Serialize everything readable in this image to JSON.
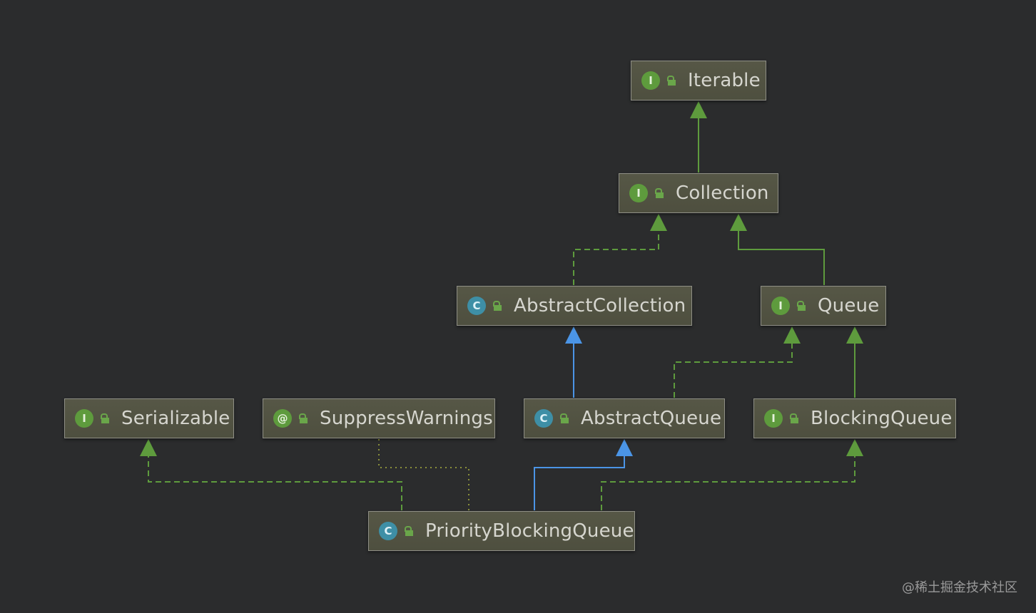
{
  "nodes": {
    "iterable": {
      "label": "Iterable",
      "kind": "I",
      "icon": "interface-icon"
    },
    "collection": {
      "label": "Collection",
      "kind": "I",
      "icon": "interface-icon"
    },
    "abstract_collection": {
      "label": "AbstractCollection",
      "kind": "C",
      "icon": "abstract-class-icon"
    },
    "queue": {
      "label": "Queue",
      "kind": "I",
      "icon": "interface-icon"
    },
    "serializable": {
      "label": "Serializable",
      "kind": "I",
      "icon": "interface-icon"
    },
    "suppress_warnings": {
      "label": "SuppressWarnings",
      "kind": "@",
      "icon": "annotation-icon"
    },
    "abstract_queue": {
      "label": "AbstractQueue",
      "kind": "C",
      "icon": "abstract-class-icon"
    },
    "blocking_queue": {
      "label": "BlockingQueue",
      "kind": "I",
      "icon": "interface-icon"
    },
    "priority_blocking_queue": {
      "label": "PriorityBlockingQueue",
      "kind": "C",
      "icon": "class-icon"
    }
  },
  "colors": {
    "background": "#2b2c2d",
    "extends_interface": "#5e9b3d",
    "extends_class": "#4b95e6",
    "implements": "#5e9b3d",
    "annotation_link": "#8a8f3a"
  },
  "watermark": "@稀土掘金技术社区"
}
